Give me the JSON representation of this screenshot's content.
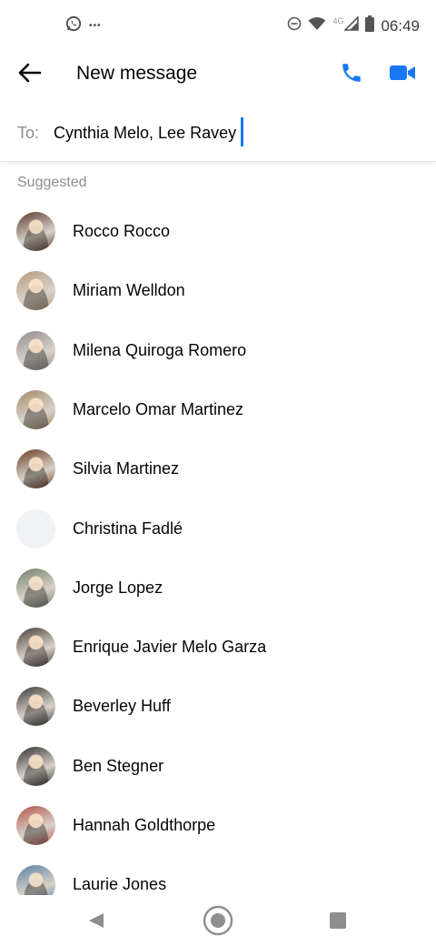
{
  "status_bar": {
    "time": "06:49",
    "network": "4G",
    "left_icons": [
      "whatsapp-icon",
      "more-dots-icon"
    ],
    "right_icons": [
      "dnd-icon",
      "wifi-icon",
      "signal-icon",
      "battery-icon"
    ]
  },
  "header": {
    "title": "New message",
    "back_icon": "back-arrow-icon",
    "call_icon": "phone-icon",
    "video_icon": "video-camera-icon",
    "accent_color": "#1877f2"
  },
  "to_field": {
    "label": "To:",
    "value": "Cynthia Melo, Lee Ravey"
  },
  "suggested": {
    "label": "Suggested",
    "contacts": [
      {
        "name": "Rocco Rocco",
        "avatar_color": "#5a3a2e"
      },
      {
        "name": "Miriam Welldon",
        "avatar_color": "#b79a7d"
      },
      {
        "name": "Milena Quiroga Romero",
        "avatar_color": "#8f8a8f"
      },
      {
        "name": "Marcelo Omar Martinez",
        "avatar_color": "#a68a6a"
      },
      {
        "name": "Silvia Martinez",
        "avatar_color": "#6b3b22"
      },
      {
        "name": "Christina Fadlé",
        "avatar_color": "#f0f2f5"
      },
      {
        "name": "Jorge Lopez",
        "avatar_color": "#6f7f6a"
      },
      {
        "name": "Enrique Javier Melo Garza",
        "avatar_color": "#4a3c34"
      },
      {
        "name": "Beverley Huff",
        "avatar_color": "#3b3a38"
      },
      {
        "name": "Ben Stegner",
        "avatar_color": "#2f2f2f"
      },
      {
        "name": "Hannah Goldthorpe",
        "avatar_color": "#b4534a"
      },
      {
        "name": "Laurie Jones",
        "avatar_color": "#5b7fa8"
      }
    ]
  },
  "nav_bar": {
    "icons": [
      "nav-back-icon",
      "nav-home-icon",
      "nav-recents-icon"
    ]
  }
}
